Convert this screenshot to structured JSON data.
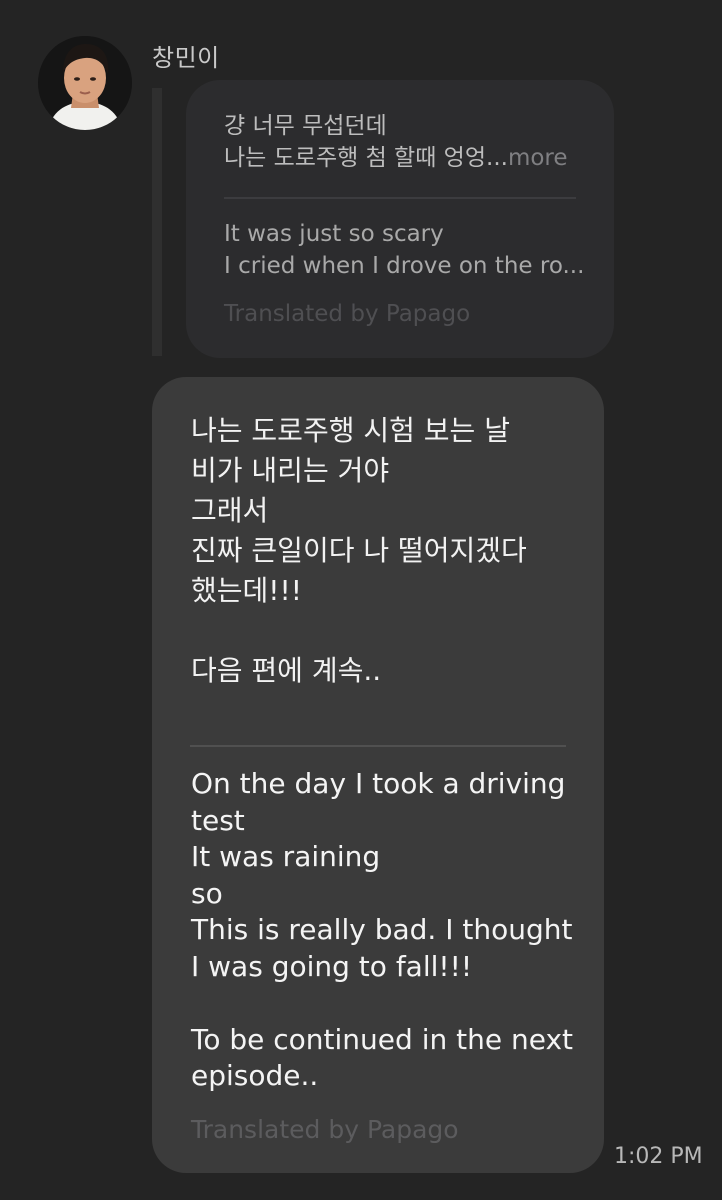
{
  "message": {
    "sender_name": "창민이",
    "timestamp": "1:02 PM"
  },
  "quoted": {
    "original_lines": [
      "걍 너무 무섭던데",
      "나는 도로주행 첨 할때 엉엉..."
    ],
    "more_label": "more",
    "translated_lines": [
      "It was just so scary",
      "I cried when I drove on the ro..."
    ],
    "attribution": "Translated by Papago"
  },
  "main": {
    "original_lines": [
      "나는 도로주행 시험 보는 날",
      "비가 내리는 거야",
      "그래서",
      "진짜 큰일이다 나 떨어지겠다",
      "했는데!!!"
    ],
    "original_continued": "다음 편에 계속..",
    "translated_lines": [
      "On the day I took a driving",
      "test",
      "It was raining",
      "so",
      "This is really bad. I thought",
      "I was going to fall!!!"
    ],
    "translated_continued": [
      "To be continued in the next",
      "episode.."
    ],
    "attribution": "Translated by Papago"
  },
  "colors": {
    "background": "#242424",
    "main_bubble": "#3b3b3b",
    "quoted_bubble": "#2c2c2e",
    "attribution_text": "#5c5c5e"
  }
}
